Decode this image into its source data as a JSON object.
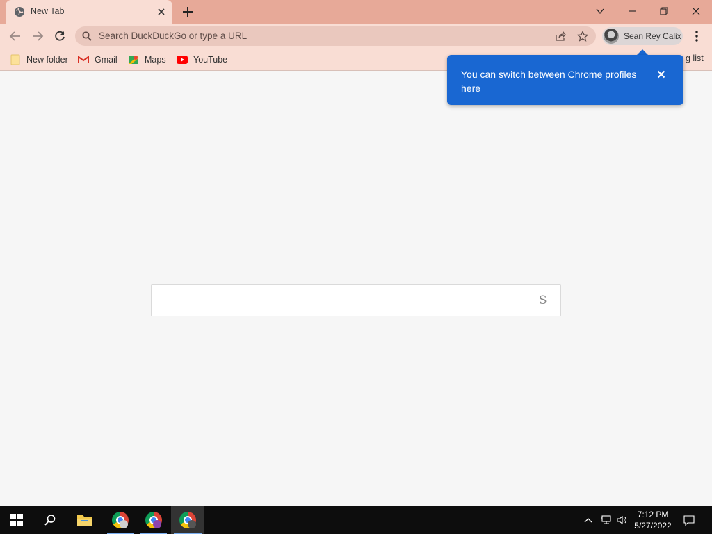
{
  "tab": {
    "title": "New Tab",
    "favicon": "globe-icon"
  },
  "omnibox": {
    "placeholder": "Search DuckDuckGo or type a URL"
  },
  "profile": {
    "name": "Sean Rey Calix"
  },
  "bookmarks": [
    {
      "label": "New folder",
      "icon": "folder-icon"
    },
    {
      "label": "Gmail",
      "icon": "gmail-icon"
    },
    {
      "label": "Maps",
      "icon": "maps-icon"
    },
    {
      "label": "YouTube",
      "icon": "youtube-icon"
    }
  ],
  "bookmarks_overflow_label": "g list",
  "popup": {
    "text": "You can switch between Chrome profiles here"
  },
  "page": {
    "search_glyph": "S"
  },
  "taskbar": {
    "time": "7:12 PM",
    "date": "5/27/2022"
  },
  "colors": {
    "titlebar": "#e7a998",
    "toolbar": "#f9ddd4",
    "popup": "#1967d2",
    "taskbar": "#0d0d0d"
  }
}
